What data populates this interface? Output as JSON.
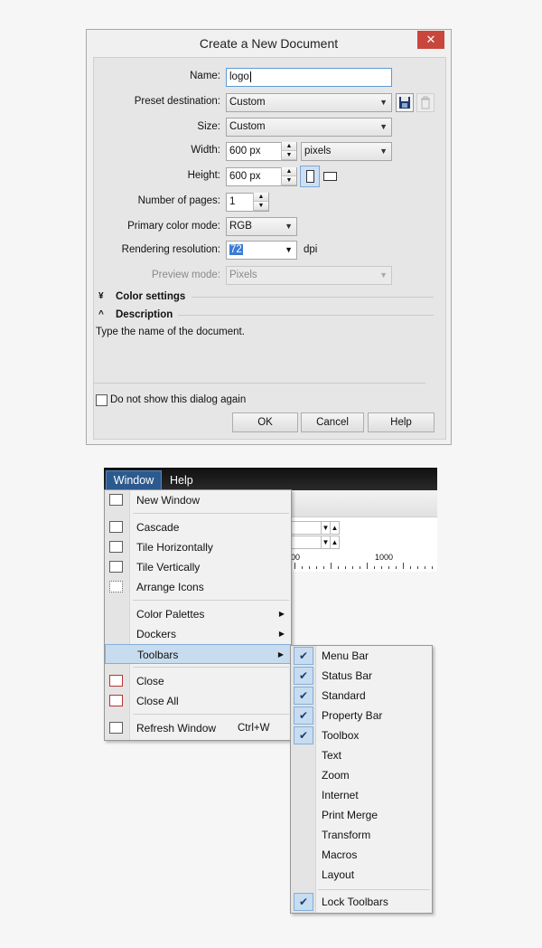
{
  "dialog": {
    "title": "Create a New Document",
    "close_icon": "close-icon",
    "name_label": "Name:",
    "name_value": "logo",
    "preset_label": "Preset destination:",
    "preset_value": "Custom",
    "size_label": "Size:",
    "size_value": "Custom",
    "width_label": "Width:",
    "width_value": "600 px",
    "units_value": "pixels",
    "height_label": "Height:",
    "height_value": "600 px",
    "pages_label": "Number of pages:",
    "pages_value": "1",
    "color_mode_label": "Primary color mode:",
    "color_mode_value": "RGB",
    "resolution_label": "Rendering resolution:",
    "resolution_value": "72",
    "resolution_unit": "dpi",
    "preview_label": "Preview mode:",
    "preview_value": "Pixels",
    "color_settings_label": "Color settings",
    "description_label": "Description",
    "description_text": "Type the name of the document.",
    "dont_show_label": "Do not show this dialog again",
    "ok_label": "OK",
    "cancel_label": "Cancel",
    "help_label": "Help"
  },
  "menubar": {
    "window_label": "Window",
    "help_label": "Help"
  },
  "ruler": {
    "label": "1000"
  },
  "window_menu": {
    "new_window": "New Window",
    "cascade": "Cascade",
    "tile_h": "Tile Horizontally",
    "tile_v": "Tile Vertically",
    "arrange": "Arrange Icons",
    "color_palettes": "Color Palettes",
    "dockers": "Dockers",
    "toolbars": "Toolbars",
    "close": "Close",
    "close_all": "Close All",
    "refresh": "Refresh Window",
    "refresh_shortcut": "Ctrl+W"
  },
  "toolbars_menu": {
    "items": [
      {
        "label": "Menu Bar",
        "checked": true
      },
      {
        "label": "Status Bar",
        "checked": true
      },
      {
        "label": "Standard",
        "checked": true
      },
      {
        "label": "Property Bar",
        "checked": true
      },
      {
        "label": "Toolbox",
        "checked": true
      },
      {
        "label": "Text",
        "checked": false
      },
      {
        "label": "Zoom",
        "checked": false
      },
      {
        "label": "Internet",
        "checked": false
      },
      {
        "label": "Print Merge",
        "checked": false
      },
      {
        "label": "Transform",
        "checked": false
      },
      {
        "label": "Macros",
        "checked": false
      },
      {
        "label": "Layout",
        "checked": false
      }
    ],
    "lock_label": "Lock Toolbars",
    "lock_checked": true
  },
  "colors": {
    "accent": "#c8dcf0",
    "close_red": "#c9463d",
    "menubar_active": "#2d5a8e"
  }
}
